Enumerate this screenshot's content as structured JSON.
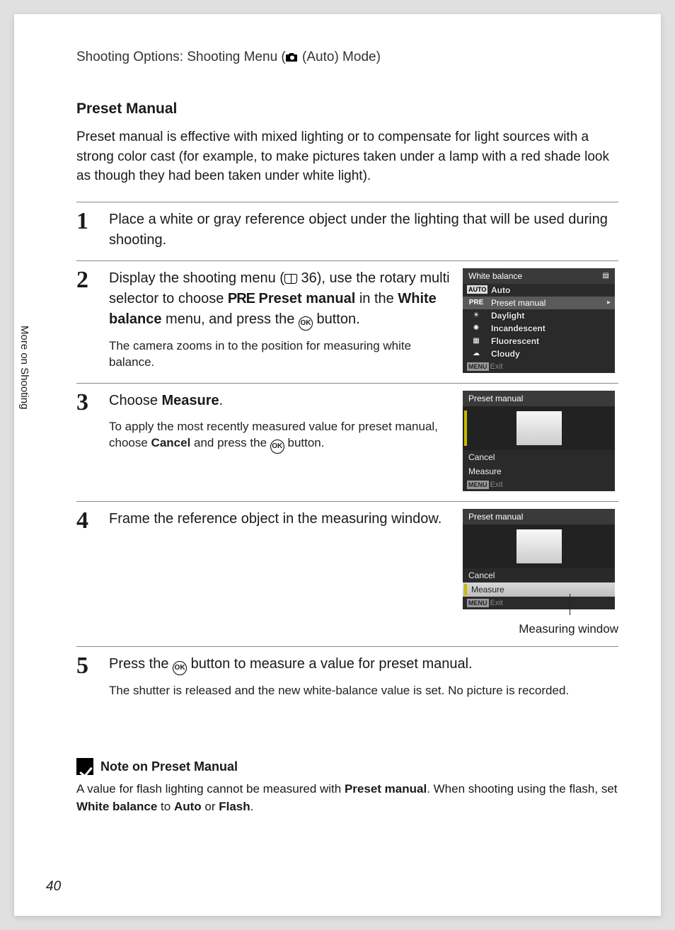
{
  "breadcrumb": {
    "prefix": "Shooting Options: Shooting Menu (",
    "suffix": " (Auto) Mode)"
  },
  "side_tab": "More on Shooting",
  "section_title": "Preset Manual",
  "intro": "Preset manual is effective with mixed lighting or to compensate for light sources with a strong color cast (for example, to make pictures taken under a lamp with a red shade look as though they had been taken under white light).",
  "steps": {
    "s1": {
      "num": "1",
      "main": "Place a white or gray reference object under the lighting that will be used during shooting."
    },
    "s2": {
      "num": "2",
      "main_a": "Display the shooting menu (",
      "main_b": " 36), use the rotary multi selector to choose ",
      "pre_label": "PRE",
      "main_c": " Preset manual",
      "main_d": " in the ",
      "main_e": "White balance",
      "main_f": " menu, and press the ",
      "ok": "OK",
      "main_g": " button.",
      "sub": "The camera zooms in to the position for measuring white balance.",
      "lcd": {
        "title": "White balance",
        "items": {
          "auto": "Auto",
          "preset": "Preset manual",
          "daylight": "Daylight",
          "incandescent": "Incandescent",
          "fluorescent": "Fluorescent",
          "cloudy": "Cloudy"
        },
        "footer_tag": "MENU",
        "footer": "Exit"
      }
    },
    "s3": {
      "num": "3",
      "main_a": "Choose ",
      "main_b": "Measure",
      "main_c": ".",
      "sub_a": "To apply the most recently measured value for preset manual, choose ",
      "sub_b": "Cancel",
      "sub_c": " and press the ",
      "ok": "OK",
      "sub_d": " button.",
      "lcd": {
        "title": "Preset manual",
        "cancel": "Cancel",
        "measure": "Measure",
        "footer_tag": "MENU",
        "footer": "Exit"
      }
    },
    "s4": {
      "num": "4",
      "main": "Frame the reference object in the measuring window.",
      "lcd": {
        "title": "Preset manual",
        "cancel": "Cancel",
        "measure": "Measure",
        "footer_tag": "MENU",
        "footer": "Exit"
      },
      "caption": "Measuring window"
    },
    "s5": {
      "num": "5",
      "main_a": "Press the ",
      "ok": "OK",
      "main_b": " button to measure a value for preset manual.",
      "sub": "The shutter is released and the new white-balance value is set. No picture is recorded."
    }
  },
  "note": {
    "title": "Note on Preset Manual",
    "body_a": "A value for flash lighting cannot be measured with ",
    "body_b": "Preset manual",
    "body_c": ". When shooting using the flash, set ",
    "body_d": "White balance",
    "body_e": " to ",
    "body_f": "Auto",
    "body_g": " or ",
    "body_h": "Flash",
    "body_i": "."
  },
  "page_num": "40"
}
